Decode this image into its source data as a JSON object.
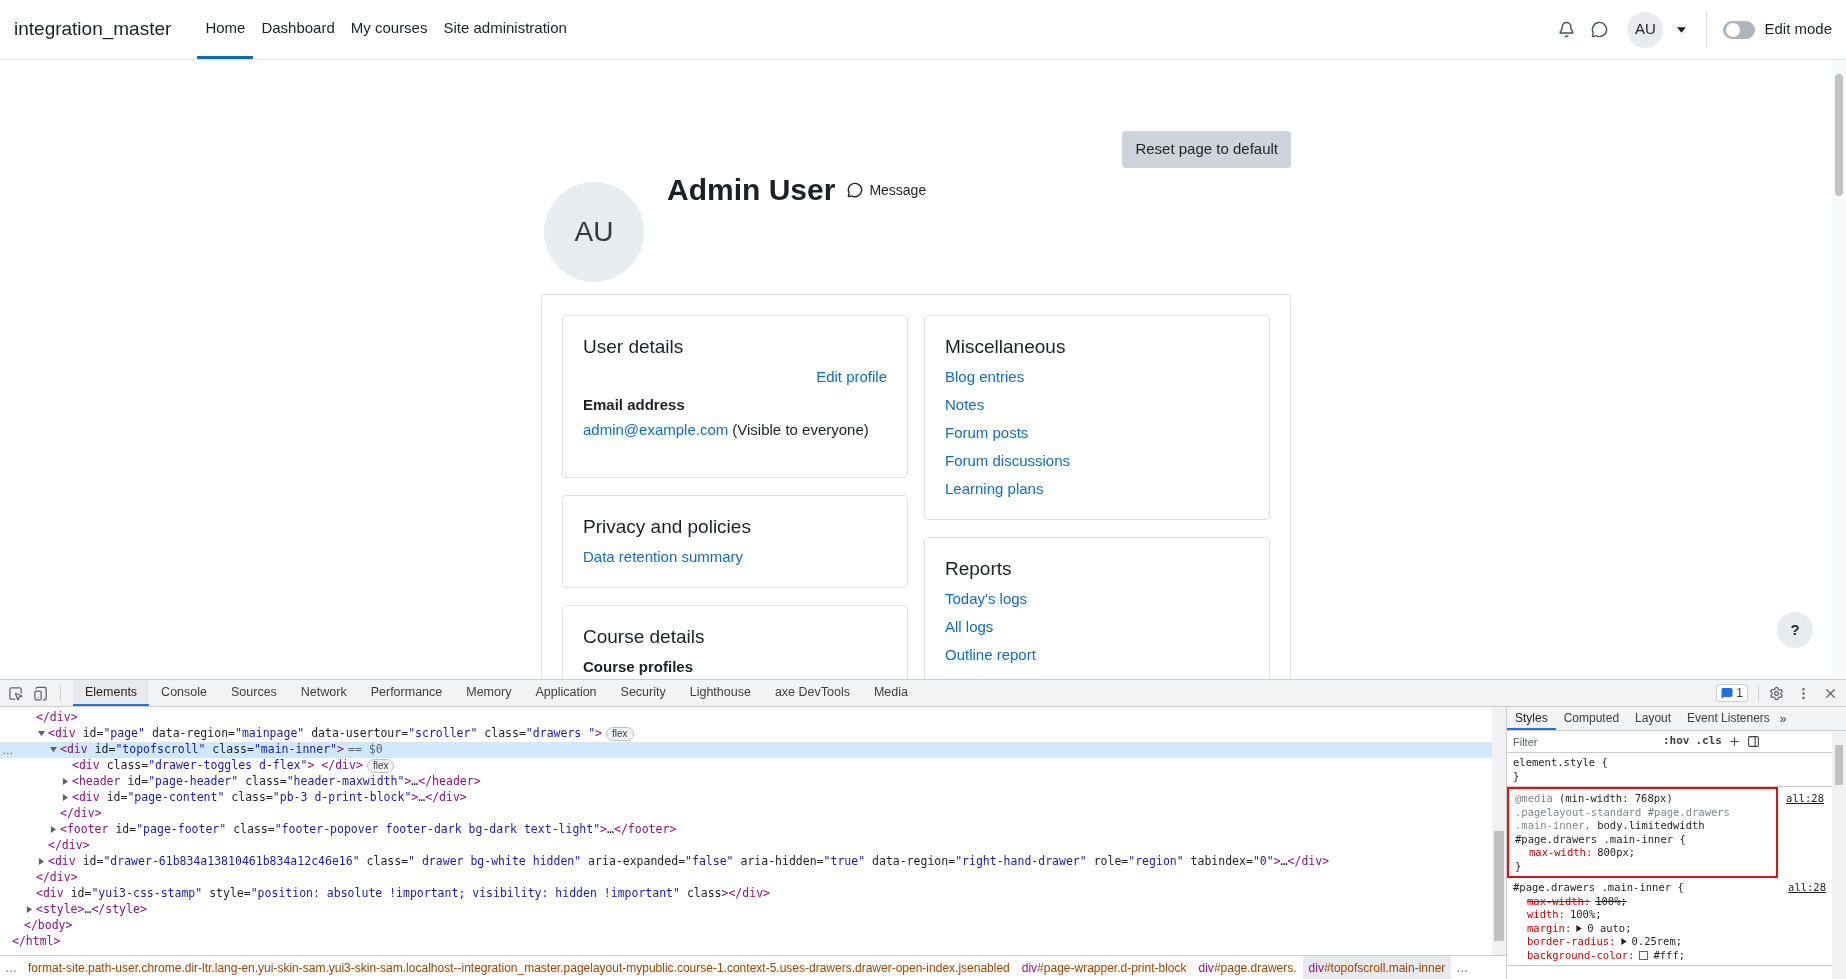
{
  "nav": {
    "brand": "integration_master",
    "items": [
      {
        "label": "Home",
        "selected": true
      },
      {
        "label": "Dashboard",
        "selected": false
      },
      {
        "label": "My courses",
        "selected": false
      },
      {
        "label": "Site administration",
        "selected": false
      }
    ],
    "avatar": "AU",
    "edit_mode": {
      "label": "Edit mode",
      "on": false
    }
  },
  "page": {
    "reset_button": "Reset page to default",
    "user": {
      "initials": "AU",
      "name": "Admin User",
      "message": "Message"
    },
    "columns": [
      [
        {
          "title": "User details",
          "items": [
            {
              "kind": "action",
              "text": "Edit profile"
            },
            {
              "kind": "heading",
              "text": "Email address"
            },
            {
              "kind": "value",
              "link": "admin@example.com",
              "note": "(Visible to everyone)"
            }
          ]
        },
        {
          "title": "Privacy and policies",
          "items": [
            {
              "kind": "link",
              "text": "Data retention summary"
            }
          ]
        },
        {
          "title": "Course details",
          "items": [
            {
              "kind": "heading",
              "text": "Course profiles"
            }
          ]
        }
      ],
      [
        {
          "title": "Miscellaneous",
          "items": [
            {
              "kind": "link",
              "text": "Blog entries"
            },
            {
              "kind": "link",
              "text": "Notes"
            },
            {
              "kind": "link",
              "text": "Forum posts"
            },
            {
              "kind": "link",
              "text": "Forum discussions"
            },
            {
              "kind": "link",
              "text": "Learning plans"
            }
          ]
        },
        {
          "title": "Reports",
          "items": [
            {
              "kind": "link",
              "text": "Today's logs"
            },
            {
              "kind": "link",
              "text": "All logs"
            },
            {
              "kind": "link",
              "text": "Outline report"
            }
          ]
        }
      ]
    ],
    "help": "?"
  },
  "devtools": {
    "tabs": [
      {
        "label": "Elements",
        "selected": true
      },
      {
        "label": "Console",
        "selected": false
      },
      {
        "label": "Sources",
        "selected": false
      },
      {
        "label": "Network",
        "selected": false
      },
      {
        "label": "Performance",
        "selected": false
      },
      {
        "label": "Memory",
        "selected": false
      },
      {
        "label": "Application",
        "selected": false
      },
      {
        "label": "Security",
        "selected": false
      },
      {
        "label": "Lighthouse",
        "selected": false
      },
      {
        "label": "axe DevTools",
        "selected": false
      },
      {
        "label": "Media",
        "selected": false
      }
    ],
    "issues": "1",
    "tree": {
      "close": "</html>",
      "children": [
        {
          "close": "</body>",
          "children": [
            {
              "text": "</div>"
            },
            {
              "close": "</div>",
              "children": [
                {
                  "text": "<div id=\"page\" data-region=\"mainpage\" data-usertour=\"scroller\" class=\"drawers  \">",
                  "badge": "flex",
                  "expanded": true,
                  "close": "</div>",
                  "children": [
                    {
                      "text": "<div id=\"topofscroll\" class=\"main-inner\">",
                      "gutter": "…",
                      "suffix": "== $0",
                      "selected": true,
                      "expanded": true,
                      "close": "</div>",
                      "children": [
                        {
                          "text": "<div class=\"drawer-toggles d-flex\"> </div>",
                          "badge": "flex"
                        },
                        {
                          "text": "<header id=\"page-header\" class=\"header-maxwidth\">…</header>",
                          "expanded": false
                        },
                        {
                          "text": "<div id=\"page-content\" class=\"pb-3 d-print-block\">…</div>",
                          "expanded": false
                        }
                      ]
                    },
                    {
                      "text": "<footer id=\"page-footer\" class=\"footer-popover footer-dark bg-dark text-light\">…</footer>",
                      "expanded": false
                    }
                  ]
                },
                {
                  "text": "<div id=\"drawer-61b834a13810461b834a12c46e16\" class=\" drawer bg-white hidden\" aria-expanded=\"false\" aria-hidden=\"true\" data-region=\"right-hand-drawer\" role=\"region\" tabindex=\"0\">…</div>",
                  "expanded": false
                }
              ]
            },
            {
              "text": "<div id=\"yui3-css-stamp\" style=\"position: absolute !important; visibility: hidden !important\" class></div>"
            },
            {
              "text": "<style>…</style>",
              "expanded": false
            }
          ]
        }
      ]
    },
    "breadcrumbs": {
      "more_left": "…",
      "items": [
        {
          "text": "format-site.path-user.chrome.dir-ltr.lang-en.yui-skin-sam.yui3-skin-sam.localhost--integration_master.pagelayout-mypublic.course-1.context-5.uses-drawers.drawer-open-index.jsenabled",
          "selected": false
        },
        {
          "text": "div#page-wrapper.d-print-block",
          "selected": false
        },
        {
          "text": "div#page.drawers.",
          "selected": false
        },
        {
          "text": "div#topofscroll.main-inner",
          "selected": true
        }
      ],
      "more_right": "…"
    },
    "styles": {
      "tabs": [
        {
          "label": "Styles",
          "selected": true
        },
        {
          "label": "Computed",
          "selected": false
        },
        {
          "label": "Layout",
          "selected": false
        },
        {
          "label": "Event Listeners",
          "selected": false
        }
      ],
      "more": "»",
      "filter_placeholder": "Filter",
      "hov": ":hov",
      "cls": ".cls",
      "rules": [
        {
          "highlighted": false,
          "selectors": [
            {
              "text": "element.style",
              "matched": true
            }
          ],
          "open": "{",
          "close": "}"
        },
        {
          "highlighted": true,
          "media": "@media",
          "query": "(min-width: 768px)",
          "selectors": [
            {
              "text": ".pagelayout-standard #page.drawers .main-inner,",
              "matched": false
            },
            {
              "text": "body.limitedwidth #page.drawers .main-inner",
              "matched": true
            }
          ],
          "open": "{",
          "close": "}",
          "source": "all:28",
          "decls": [
            {
              "prop": "max-width:",
              "value": "800px;",
              "overridden": false,
              "expandable": false
            }
          ]
        },
        {
          "highlighted": false,
          "selectors": [
            {
              "text": "#page.drawers .main-inner",
              "matched": true
            }
          ],
          "open": "{",
          "source": "all:28",
          "decls": [
            {
              "prop": "max-width:",
              "value": "100%;",
              "overridden": true,
              "expandable": false
            },
            {
              "prop": "width:",
              "value": "100%;",
              "overridden": false,
              "expandable": false
            },
            {
              "prop": "margin:",
              "value": "0 auto;",
              "overridden": false,
              "expandable": true
            },
            {
              "prop": "border-radius:",
              "value": "0.25rem;",
              "overridden": false,
              "expandable": true
            },
            {
              "prop": "background-color:",
              "value": "#fff;",
              "overridden": false,
              "expandable": false,
              "color": "#ffffff"
            }
          ]
        }
      ]
    }
  }
}
